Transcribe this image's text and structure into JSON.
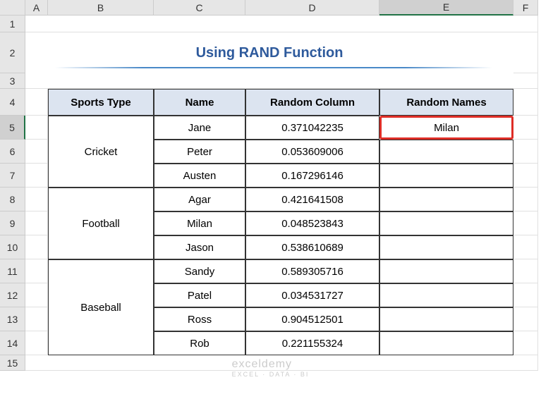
{
  "columns": [
    "A",
    "B",
    "C",
    "D",
    "E",
    "F"
  ],
  "rows": [
    "1",
    "2",
    "3",
    "4",
    "5",
    "6",
    "7",
    "8",
    "9",
    "10",
    "11",
    "12",
    "13",
    "14",
    "15"
  ],
  "activeColumn": "E",
  "activeRow": "5",
  "title": "Using RAND Function",
  "headers": {
    "sports": "Sports Type",
    "name": "Name",
    "random_col": "Random Column",
    "random_names": "Random Names"
  },
  "sports": [
    "Cricket",
    "Football",
    "Baseball"
  ],
  "data": [
    {
      "name": "Jane",
      "val": "0.371042235"
    },
    {
      "name": "Peter",
      "val": "0.053609006"
    },
    {
      "name": "Austen",
      "val": "0.167296146"
    },
    {
      "name": "Agar",
      "val": "0.421641508"
    },
    {
      "name": "Milan",
      "val": "0.048523843"
    },
    {
      "name": "Jason",
      "val": "0.538610689"
    },
    {
      "name": "Sandy",
      "val": "0.589305716"
    },
    {
      "name": "Patel",
      "val": "0.034531727"
    },
    {
      "name": "Ross",
      "val": "0.904512501"
    },
    {
      "name": "Rob",
      "val": "0.221155324"
    }
  ],
  "result": "Milan",
  "watermark": {
    "main": "exceldemy",
    "sub": "EXCEL · DATA · BI"
  }
}
